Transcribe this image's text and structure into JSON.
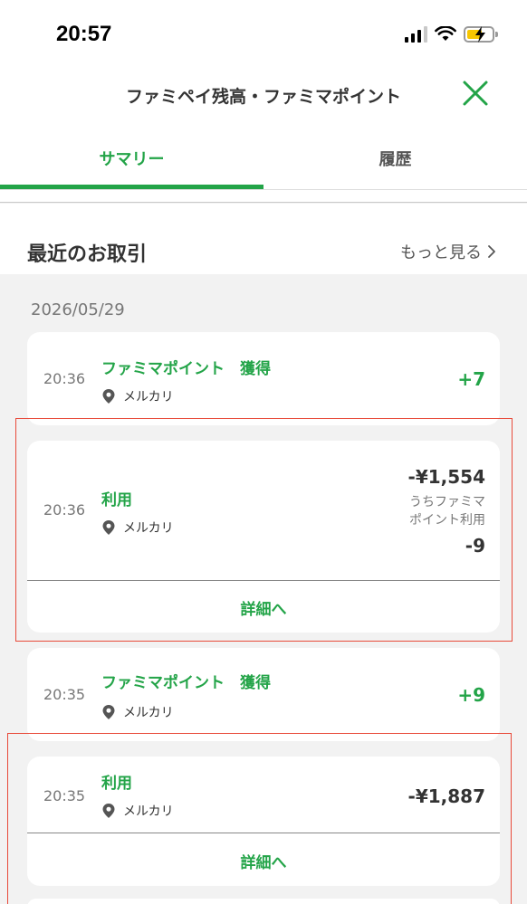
{
  "status_bar": {
    "time": "20:57"
  },
  "header": {
    "title": "ファミペイ残高・ファミマポイント"
  },
  "tabs": [
    {
      "label": "サマリー",
      "active": true
    },
    {
      "label": "履歴",
      "active": false
    }
  ],
  "recent": {
    "title": "最近のお取引",
    "more_label": "もっと見る"
  },
  "date_group": "2026/05/29",
  "transactions": [
    {
      "time": "20:36",
      "title": "ファミマポイント　獲得",
      "store": "メルカリ",
      "amount": "+7"
    },
    {
      "time": "20:36",
      "title": "利用",
      "store": "メルカリ",
      "amount": "-¥1,554",
      "sub_label_1": "うちファミマ",
      "sub_label_2": "ポイント利用",
      "sub_amount": "-9",
      "detail_label": "詳細へ"
    },
    {
      "time": "20:35",
      "title": "ファミマポイント　獲得",
      "store": "メルカリ",
      "amount": "+9"
    },
    {
      "time": "20:35",
      "title": "利用",
      "store": "メルカリ",
      "amount": "-¥1,887",
      "detail_label": "詳細へ"
    }
  ],
  "colors": {
    "accent": "#23a448",
    "highlight": "#e84a3a",
    "background": "#f2f2f2"
  },
  "icons": [
    "signal-icon",
    "wifi-icon",
    "battery-charging-icon",
    "close-icon",
    "chevron-right-icon",
    "location-pin-icon"
  ]
}
